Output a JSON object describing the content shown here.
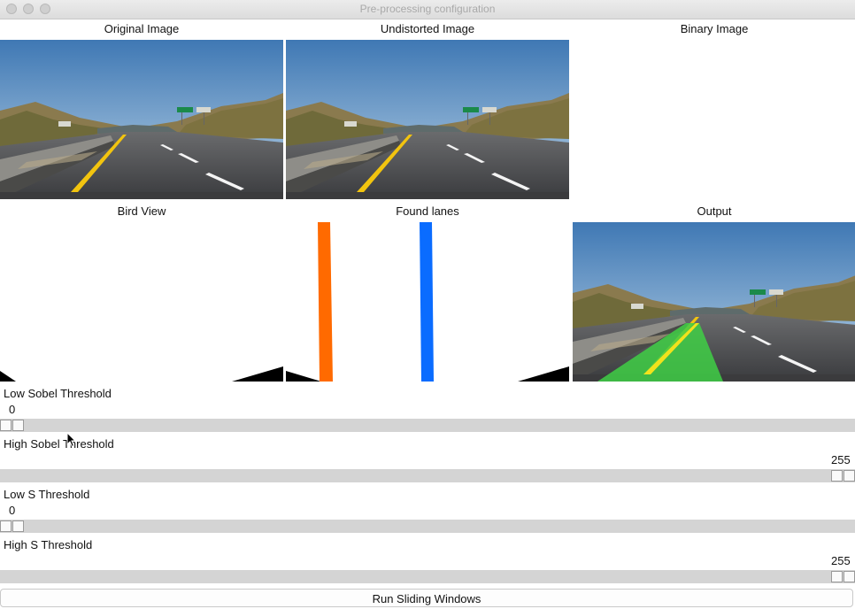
{
  "window": {
    "title": "Pre-processing configuration"
  },
  "panels": {
    "original": {
      "label": "Original Image"
    },
    "undistorted": {
      "label": "Undistorted Image"
    },
    "binary": {
      "label": "Binary Image"
    },
    "bird_view": {
      "label": "Bird View"
    },
    "found_lanes": {
      "label": "Found lanes"
    },
    "output": {
      "label": "Output"
    }
  },
  "sliders": {
    "low_sobel": {
      "label": "Low Sobel Threshold",
      "value": "0",
      "position": 0
    },
    "high_sobel": {
      "label": "High Sobel Threshold",
      "value": "255",
      "position": 1
    },
    "low_s": {
      "label": "Low S Threshold",
      "value": "0",
      "position": 0
    },
    "high_s": {
      "label": "High S Threshold",
      "value": "255",
      "position": 1
    }
  },
  "buttons": {
    "run_label": "Run Sliding Windows"
  },
  "icons": {
    "window_controls": [
      "close-icon",
      "minimize-icon",
      "zoom-icon"
    ],
    "cursor": "arrow-cursor-icon"
  },
  "colors": {
    "left_lane": "#ff6a00",
    "right_lane": "#0a6cff",
    "lane_fill": "#3fcf45",
    "lane_line": "#f2e21c",
    "track": "#d4d4d4"
  }
}
